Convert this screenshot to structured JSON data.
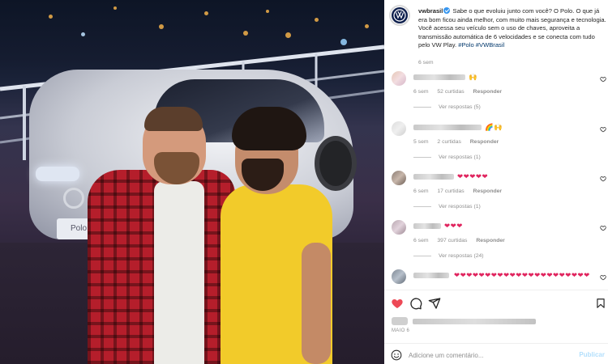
{
  "post": {
    "username": "vwbrasil",
    "caption_text": " Sabe o que evoluiu junto com você? O Polo. O que já era bom ficou ainda melhor, com muito mais segurança e tecnologia. Você acessa seu veículo sem o uso de chaves, aproveita a transmissão automática de 6 velocidades e se conecta com tudo pelo VW Play. ",
    "hashtags": "#Polo #VWBrasil",
    "time": "6 sem",
    "image_plate": "Polo"
  },
  "comments": [
    {
      "emoji": "🙌",
      "time": "6 sem",
      "likes": "52 curtidas",
      "reply": "Responder",
      "replies": "Ver respostas (5)"
    },
    {
      "emoji": "🌈🙌",
      "time": "5 sem",
      "likes": "2 curtidas",
      "reply": "Responder",
      "replies": "Ver respostas (1)"
    },
    {
      "emoji": "❤❤❤❤❤",
      "time": "6 sem",
      "likes": "17 curtidas",
      "reply": "Responder",
      "replies": "Ver respostas (1)"
    },
    {
      "emoji": "❤❤❤",
      "time": "6 sem",
      "likes": "397 curtidas",
      "reply": "Responder",
      "replies": "Ver respostas (24)"
    },
    {
      "emoji": "❤❤❤❤❤❤❤❤❤❤❤❤❤❤❤❤❤❤❤❤❤❤",
      "time": "",
      "likes": "",
      "reply": "",
      "replies": ""
    }
  ],
  "footer": {
    "post_time": "MAIO 6",
    "add_comment_placeholder": "Adicione um comentário...",
    "publish_label": "Publicar"
  },
  "colors": {
    "like_red": "#ed4956",
    "link_blue": "#00376b",
    "meta_gray": "#8e8e8e",
    "publish_disabled": "#b2dffc"
  },
  "icons": [
    "heart-filled-icon",
    "comment-icon",
    "share-icon",
    "bookmark-icon",
    "emoji-icon",
    "verified-icon",
    "small-heart-icon"
  ]
}
